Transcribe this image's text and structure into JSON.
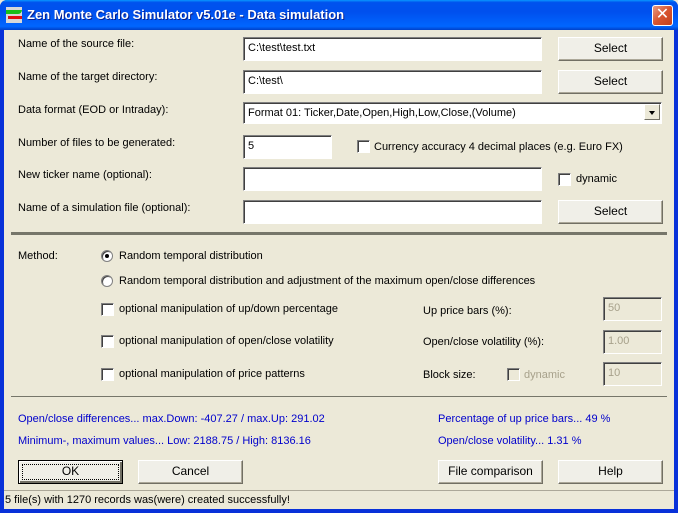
{
  "window": {
    "title": "Zen Monte Carlo Simulator v5.01e - Data simulation",
    "close_label": "✕",
    "app_icon": "app-chart-icon"
  },
  "form": {
    "source_file": {
      "label": "Name of the source file:",
      "value": "C:\\test\\test.txt",
      "button": "Select"
    },
    "target_dir": {
      "label": "Name of the target directory:",
      "value": "C:\\test\\",
      "button": "Select"
    },
    "data_format": {
      "label": "Data format (EOD or Intraday):",
      "selected": "Format 01: Ticker,Date,Open,High,Low,Close,(Volume)"
    },
    "num_files": {
      "label": "Number of files to be generated:",
      "value": "5"
    },
    "currency_accuracy": {
      "label": "Currency accuracy 4 decimal places (e.g. Euro FX)",
      "checked": false
    },
    "ticker_name": {
      "label": "New ticker name (optional):",
      "value": "",
      "dynamic_label": "dynamic",
      "dynamic_checked": false
    },
    "simulation_file": {
      "label": "Name of a simulation file (optional):",
      "value": "",
      "button": "Select"
    }
  },
  "method": {
    "label": "Method:",
    "options": [
      {
        "label": "Random temporal distribution",
        "selected": true
      },
      {
        "label": "Random temporal distribution and adjustment of the maximum open/close differences",
        "selected": false
      }
    ],
    "manipulations": [
      {
        "label": "optional manipulation of up/down percentage",
        "checked": false,
        "field_label": "Up price bars (%):",
        "field_value": "50"
      },
      {
        "label": "optional manipulation of open/close volatility",
        "checked": false,
        "field_label": "Open/close volatility (%):",
        "field_value": "1.00"
      },
      {
        "label": "optional manipulation of price patterns",
        "checked": false,
        "field_label": "Block size:",
        "field_value": "10",
        "dynamic_label": "dynamic",
        "dynamic_checked": false
      }
    ]
  },
  "results": {
    "open_close_diff": "Open/close differences...  max.Down:  -407.27  /  max.Up:  291.02",
    "min_max": "Minimum-, maximum values...  Low:  2188.75  /  High:  8136.16",
    "up_percentage": "Percentage of up price bars...  49  %",
    "volatility": "Open/close volatility...  1.31  %"
  },
  "buttons": {
    "ok": "OK",
    "cancel": "Cancel",
    "file_comparison": "File comparison",
    "help": "Help"
  },
  "status": {
    "text": "5 file(s) with  1270 records was(were) created successfully!"
  }
}
